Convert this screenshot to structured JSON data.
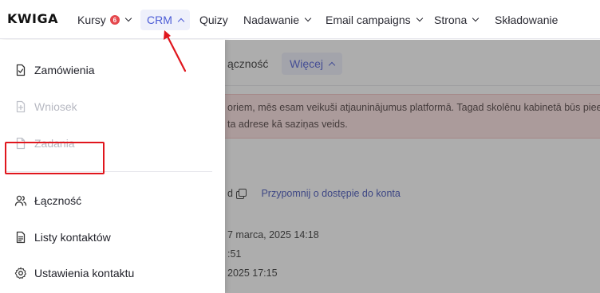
{
  "logo": "KWIGA",
  "nav": {
    "items": [
      {
        "label": "Kursy",
        "badge": "6"
      },
      {
        "label": "CRM"
      },
      {
        "label": "Quizy"
      },
      {
        "label": "Nadawanie"
      },
      {
        "label": "Email campaigns"
      },
      {
        "label": "Strona"
      },
      {
        "label": "Składowanie"
      }
    ]
  },
  "dropdown": {
    "items": [
      {
        "label": "Zamówienia",
        "icon": "document-check-icon",
        "disabled": false
      },
      {
        "label": "Wniosek",
        "icon": "document-plus-icon",
        "disabled": true
      },
      {
        "label": "Zadania",
        "icon": "document-icon",
        "disabled": true
      },
      {
        "label": "Łączność",
        "icon": "users-icon",
        "disabled": false
      },
      {
        "label": "Listy kontaktów",
        "icon": "document-lines-icon",
        "disabled": false
      },
      {
        "label": "Ustawienia kontaktu",
        "icon": "gear-icon",
        "disabled": false
      }
    ]
  },
  "background": {
    "tab_text": "ączność",
    "more_label": "Więcej",
    "alert_line1": "oriem, mēs esam veikuši atjauninājumus platformā. Tagad skolēnu kabinetā būs pieejama",
    "alert_line2": "ta adrese kā saziņas veids.",
    "copy_suffix": "d",
    "reminder_link": "Przypomnij o dostępie do konta",
    "date1": "7 marca, 2025 14:18",
    "time2": ":51",
    "date3": "2025 17:15"
  },
  "colors": {
    "accent": "#4b5bd6",
    "highlight": "#e0161d",
    "alert_bg": "#fbe1e1"
  }
}
